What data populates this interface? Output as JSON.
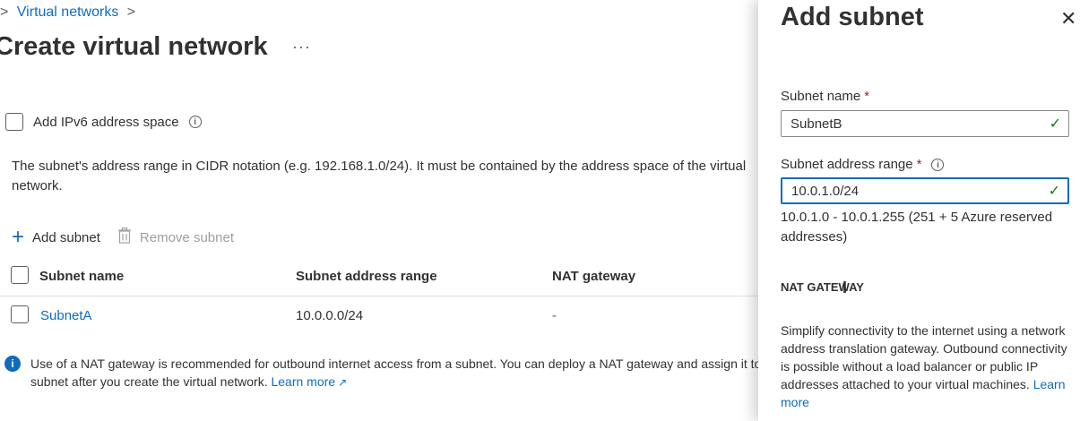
{
  "breadcrumb": {
    "prefix": ">",
    "item": "Virtual networks",
    "suffix": ">"
  },
  "page": {
    "title": "Create virtual network",
    "more": "···"
  },
  "ipv6": {
    "label": "Add IPv6 address space",
    "info_icon": "info-icon"
  },
  "description": "The subnet's address range in CIDR notation (e.g. 192.168.1.0/24). It must be contained by the address space of the virtual network.",
  "toolbar": {
    "add_label": "Add subnet",
    "remove_label": "Remove subnet"
  },
  "table": {
    "headers": [
      "Subnet name",
      "Subnet address range",
      "NAT gateway"
    ],
    "rows": [
      {
        "name": "SubnetA",
        "range": "10.0.0.0/24",
        "nat": "-"
      }
    ]
  },
  "notice": {
    "text": "Use of a NAT gateway is recommended for outbound internet access from a subnet. You can deploy a NAT gateway and assign it to a subnet after you create the virtual network.",
    "link": "Learn more"
  },
  "panel": {
    "title": "Add subnet",
    "close_icon": "close-icon",
    "subnet_name_label": "Subnet name",
    "subnet_name_value": "SubnetB",
    "range_label": "Subnet address range",
    "range_value": "10.0.1.0/24",
    "required_mark": "*",
    "range_info": "10.0.1.0 - 10.0.1.255 (251 + 5 Azure reserved addresses)",
    "nat_heading": "NAT GATEWAY",
    "nat_desc": "Simplify connectivity to the internet using a network address translation gateway. Outbound connectivity is possible without a load balancer or public IP addresses attached to your virtual machines.",
    "nat_link": "Learn more"
  },
  "colors": {
    "accent": "#0f6cbd",
    "success": "#107c10",
    "required": "#a4262c"
  }
}
